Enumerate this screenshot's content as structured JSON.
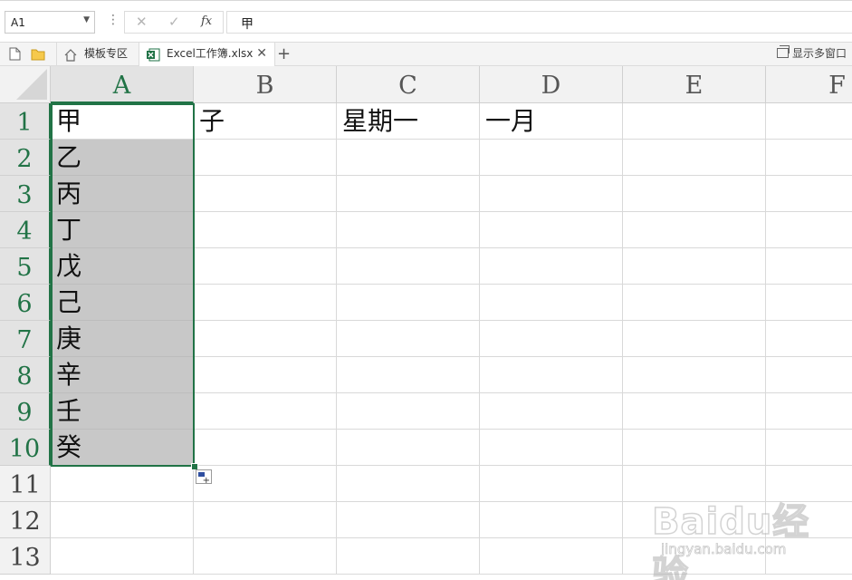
{
  "formula_bar": {
    "name_box": "A1",
    "cancel_icon": "✕",
    "confirm_icon": "✓",
    "function_icon": "fx",
    "formula": "甲"
  },
  "tab_bar": {
    "tabs": [
      {
        "label": "模板专区"
      },
      {
        "label": "Excel工作簿.xlsx"
      }
    ],
    "new_tab": "+",
    "close": "✕",
    "multi_window": "显示多窗口"
  },
  "grid": {
    "columns": [
      "A",
      "B",
      "C",
      "D",
      "E",
      "F"
    ],
    "rows": [
      "1",
      "2",
      "3",
      "4",
      "5",
      "6",
      "7",
      "8",
      "9",
      "10",
      "11",
      "12",
      "13"
    ],
    "cells": {
      "A1": "甲",
      "B1": "子",
      "C1": "星期一",
      "D1": "一月",
      "A2": "乙",
      "A3": "丙",
      "A4": "丁",
      "A5": "戊",
      "A6": "己",
      "A7": "庚",
      "A8": "辛",
      "A9": "壬",
      "A10": "癸"
    },
    "active_cell": "A1",
    "selection": "A1:A10",
    "accent_color": "#217346"
  },
  "watermark": {
    "logo": "Baidu经验",
    "url": "jingyan.baidu.com"
  }
}
